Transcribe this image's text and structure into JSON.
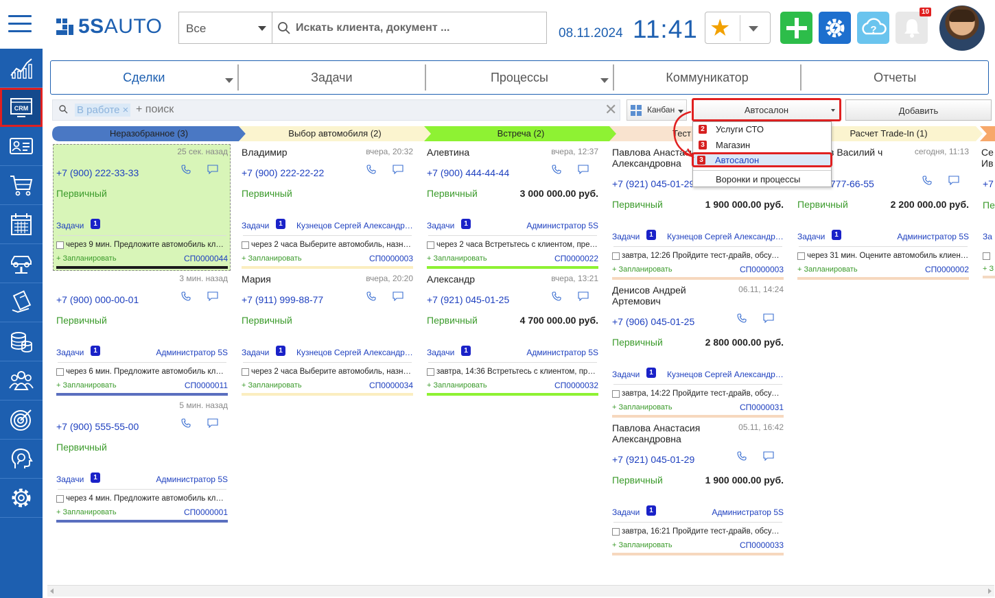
{
  "header": {
    "logo_text": "5SAUTO",
    "scope_value": "Все",
    "search_placeholder": "Искать клиента, документ ...",
    "date": "08.11.2024",
    "time": "11:41",
    "notifications_count": "10",
    "colors": {
      "brand": "#1d5fb0",
      "add": "#2dbd4a",
      "settings": "#1d6fce",
      "help": "#6ac4ee"
    }
  },
  "sidebar": {
    "items": [
      {
        "icon": "analytics-icon",
        "active": false
      },
      {
        "icon": "crm-icon",
        "label": "CRM",
        "active": true
      },
      {
        "icon": "contacts-card-icon",
        "active": false
      },
      {
        "icon": "cart-icon",
        "active": false
      },
      {
        "icon": "calendar-icon",
        "active": false
      },
      {
        "icon": "car-lift-icon",
        "active": false
      },
      {
        "icon": "delivery-icon",
        "active": false
      },
      {
        "icon": "coins-icon",
        "active": false
      },
      {
        "icon": "team-icon",
        "active": false
      },
      {
        "icon": "target-icon",
        "active": false
      },
      {
        "icon": "support-icon",
        "active": false
      },
      {
        "icon": "gear-icon",
        "active": false
      }
    ]
  },
  "tabs": [
    {
      "label": "Сделки",
      "active": true,
      "dropdown": true
    },
    {
      "label": "Задачи",
      "active": false,
      "dropdown": false
    },
    {
      "label": "Процессы",
      "active": false,
      "dropdown": true
    },
    {
      "label": "Коммуникатор",
      "active": false,
      "dropdown": false
    },
    {
      "label": "Отчеты",
      "active": false,
      "dropdown": false
    }
  ],
  "filter": {
    "chip": "В работе",
    "placeholder": "+ поиск",
    "view": "Канбан",
    "funnel": "Автосалон",
    "add_label": "Добавить"
  },
  "funnel_menu": [
    {
      "count": "2",
      "label": "Услуги СТО"
    },
    {
      "count": "3",
      "label": "Магазин"
    },
    {
      "count": "3",
      "label": "Автосалон",
      "selected": true
    },
    {
      "count": "",
      "label": "Воронки и процессы"
    }
  ],
  "stages": [
    {
      "label": "Неразобранное (3)",
      "color": "#4a78c4"
    },
    {
      "label": "Выбор автомобиля (2)",
      "color": "#fbf4cf"
    },
    {
      "label": "Встреча (2)",
      "color": "#8ef233"
    },
    {
      "label": "Тест",
      "color": "#f9e3cf"
    },
    {
      "label": "Расчет Trade-In (1)",
      "color": "#fbf4cf"
    }
  ],
  "common": {
    "tasks_label": "Задачи",
    "plan_label": "+ Запланировать",
    "type_primary": "Первичный"
  },
  "cards": [
    {
      "name": "",
      "when": "25 сек. назад",
      "phone": "+7 (900) 222-33-33",
      "type": "Первичный",
      "amount": "",
      "tasks": "1",
      "assignee": "",
      "task": "через 9 мин. Предложите автомобиль клиен...",
      "code": "СП0000044"
    },
    {
      "name": "",
      "when": "3 мин. назад",
      "phone": "+7 (900) 000-00-01",
      "type": "Первичный",
      "amount": "",
      "tasks": "1",
      "assignee": "Администратор 5S",
      "task": "через 6 мин. Предложите автомобиль клиен...",
      "code": "СП0000011"
    },
    {
      "name": "",
      "when": "5 мин. назад",
      "phone": "+7 (900) 555-55-00",
      "type": "Первичный",
      "amount": "",
      "tasks": "1",
      "assignee": "Администратор 5S",
      "task": "через 4 мин. Предложите автомобиль клиен...",
      "code": "СП0000001"
    },
    {
      "name": "Владимир",
      "when": "вчера, 20:32",
      "phone": "+7 (900) 222-22-22",
      "type": "Первичный",
      "amount": "",
      "tasks": "1",
      "assignee": "Кузнецов Сергей Александров...",
      "task": "через 2 часа Выберите автомобиль, назначь...",
      "code": "СП0000003"
    },
    {
      "name": "Мария",
      "when": "вчера, 20:20",
      "phone": "+7 (911) 999-88-77",
      "type": "Первичный",
      "amount": "",
      "tasks": "1",
      "assignee": "Кузнецов Сергей Александров...",
      "task": "через 2 часа Выберите автомобиль, назначь...",
      "code": "СП0000034"
    },
    {
      "name": "Алевтина",
      "when": "вчера, 12:37",
      "phone": "+7 (900) 444-44-44",
      "type": "Первичный",
      "amount": "3 000 000.00 руб.",
      "tasks": "1",
      "assignee": "Администратор 5S",
      "task": "через 2 часа Встретьтесь с клиентом, предл...",
      "code": "СП0000022"
    },
    {
      "name": "Александр",
      "when": "вчера, 13:21",
      "phone": "+7 (921) 045-01-25",
      "type": "Первичный",
      "amount": "4 700 000.00 руб.",
      "tasks": "1",
      "assignee": "Администратор 5S",
      "task": "завтра, 14:36 Встретьтесь с клиентом, пред...",
      "code": "СП0000032"
    },
    {
      "name": "Павлова Анастасия Александровна",
      "when": "",
      "phone": "+7 (921) 045-01-29",
      "type": "Первичный",
      "amount": "1 900 000.00 руб.",
      "tasks": "1",
      "assignee": "Кузнецов Сергей Александров...",
      "task": "завтра, 12:26 Пройдите тест-драйв, обсудите...",
      "code": "СП0000003"
    },
    {
      "name": "Денисов Андрей Артемович",
      "when": "06.11, 14:24",
      "phone": "+7 (906) 045-01-25",
      "type": "Первичный",
      "amount": "2 800 000.00 руб.",
      "tasks": "1",
      "assignee": "Кузнецов Сергей Александров...",
      "task": "завтра, 14:22 Пройдите тест-драйв, обсудите...",
      "code": "СП0000031"
    },
    {
      "name": "Павлова Анастасия Александровна",
      "when": "05.11, 16:42",
      "phone": "+7 (921) 045-01-29",
      "type": "Первичный",
      "amount": "1 900 000.00 руб.",
      "tasks": "1",
      "assignee": "Администратор 5S",
      "task": "завтра, 16:21 Пройдите тест-драйв, обсудите...",
      "code": "СП0000033"
    },
    {
      "name": "в Василий ч",
      "when": "сегодня, 11:13",
      "phone": "777-66-55",
      "type": "Первичный",
      "amount": "2 200 000.00 руб.",
      "tasks": "1",
      "assignee": "Администратор 5S",
      "task": "через 31 мин. Оцените автомобиль клиента ...",
      "code": "СП0000002"
    }
  ],
  "partial_column": {
    "name_line1": "Се",
    "name_line2": "Ив",
    "phone": "+7",
    "type": "Пе",
    "tasks": "За",
    "plan": "+ З"
  }
}
